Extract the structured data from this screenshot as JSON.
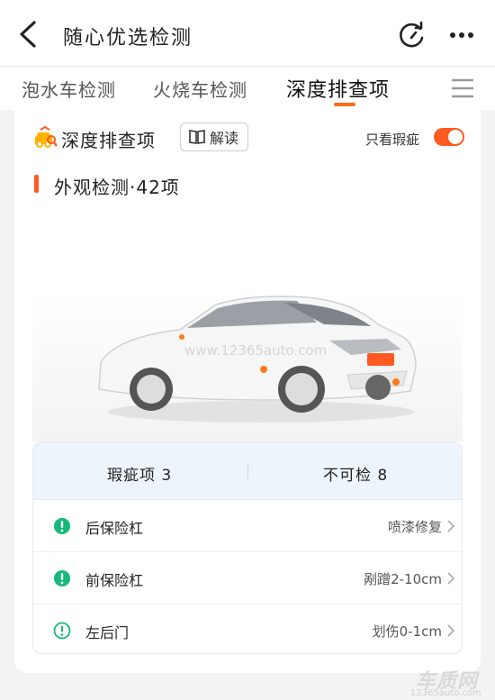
{
  "nav": {
    "title": "随心优选检测",
    "back_icon": "back-arrow-icon",
    "refresh_icon": "refresh-icon",
    "more_icon": "more-icon"
  },
  "tabs": [
    {
      "label": "泡水车检测",
      "active": false
    },
    {
      "label": "火烧车检测",
      "active": false
    },
    {
      "label": "深度排查项",
      "active": true
    }
  ],
  "card": {
    "title": "深度排查项",
    "explain_label": "解读",
    "flaw_only_label": "只看瑕疵",
    "flaw_only_on": true,
    "section_title": "外观检测·42项",
    "watermark_url": "www.12365auto.com"
  },
  "stats": {
    "flaws": "瑕疵项 3",
    "uncheckable": "不可检 8"
  },
  "items": [
    {
      "name": "后保险杠",
      "value": "喷漆修复",
      "status": "defect"
    },
    {
      "name": "前保险杠",
      "value": "剐蹭2-10cm",
      "status": "defect"
    },
    {
      "name": "左后门",
      "value": "划伤0-1cm",
      "status": "minor"
    }
  ],
  "colors": {
    "accent": "#ff5a1f",
    "defect_green": "#16b97a",
    "stats_bg": "#eef4fb"
  },
  "watermark": {
    "main": "车质网",
    "sub": "12365auto.com"
  }
}
